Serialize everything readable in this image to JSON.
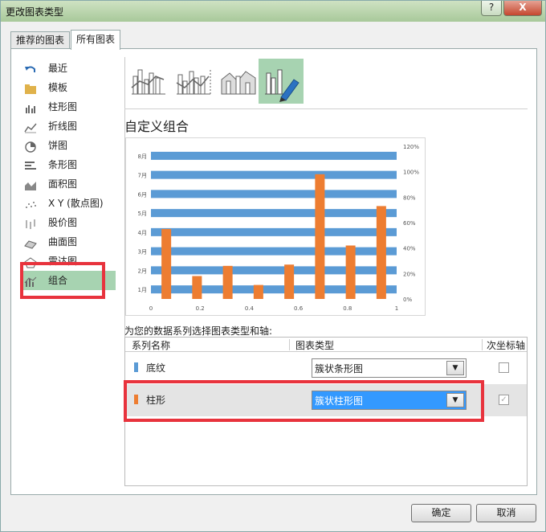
{
  "window": {
    "title": "更改图表类型",
    "help": "?",
    "close": "X"
  },
  "tabs": [
    "推荐的图表",
    "所有图表"
  ],
  "sidebar": {
    "items": [
      {
        "label": "最近",
        "icon": "undo-icon"
      },
      {
        "label": "模板",
        "icon": "folder-icon"
      },
      {
        "label": "柱形图",
        "icon": "column-chart-icon"
      },
      {
        "label": "折线图",
        "icon": "line-chart-icon"
      },
      {
        "label": "饼图",
        "icon": "pie-chart-icon"
      },
      {
        "label": "条形图",
        "icon": "bar-chart-icon"
      },
      {
        "label": "面积图",
        "icon": "area-chart-icon"
      },
      {
        "label": "X Y (散点图)",
        "icon": "scatter-chart-icon"
      },
      {
        "label": "股价图",
        "icon": "stock-chart-icon"
      },
      {
        "label": "曲面图",
        "icon": "surface-chart-icon"
      },
      {
        "label": "雷达图",
        "icon": "radar-chart-icon"
      },
      {
        "label": "组合",
        "icon": "combo-chart-icon",
        "selected": true
      }
    ]
  },
  "combo_subtypes": [
    "clustered-column-line-icon",
    "clustered-column-line-secondary-icon",
    "stacked-area-column-icon",
    "custom-combination-icon"
  ],
  "section_title": "自定义组合",
  "chart_data": {
    "type": "bar",
    "categories": [
      "1月",
      "2月",
      "3月",
      "4月",
      "5月",
      "6月",
      "7月",
      "8月"
    ],
    "series": [
      {
        "name": "底纹",
        "orientation": "horizontal",
        "axis": "primary",
        "color": "#5b9bd5",
        "values": [
          1,
          1,
          1,
          1,
          1,
          1,
          1,
          1
        ]
      },
      {
        "name": "柱形",
        "orientation": "vertical",
        "axis": "secondary",
        "color": "#ed7d31",
        "values": [
          0.55,
          0.18,
          0.26,
          0.11,
          0.27,
          0.98,
          0.42,
          0.73
        ]
      }
    ],
    "x_axis": {
      "ticks": [
        "0",
        "0.2",
        "0.4",
        "0.6",
        "0.8",
        "1"
      ],
      "range": [
        0,
        1
      ]
    },
    "y2_axis": {
      "ticks": [
        "0%",
        "20%",
        "40%",
        "60%",
        "80%",
        "100%",
        "120%"
      ],
      "range": [
        0,
        1.2
      ]
    },
    "grid": false,
    "legend": "none"
  },
  "series_caption": "为您的数据系列选择图表类型和轴:",
  "table": {
    "headers": {
      "name": "系列名称",
      "type": "图表类型",
      "axis": "次坐标轴"
    },
    "rows": [
      {
        "name": "底纹",
        "color": "#5b9bd5",
        "type": "簇状条形图",
        "secondary": false
      },
      {
        "name": "柱形",
        "color": "#ed7d31",
        "type": "簇状柱形图",
        "secondary": true
      }
    ]
  },
  "buttons": {
    "ok": "确定",
    "cancel": "取消"
  },
  "annotation_color": "#e8333d"
}
